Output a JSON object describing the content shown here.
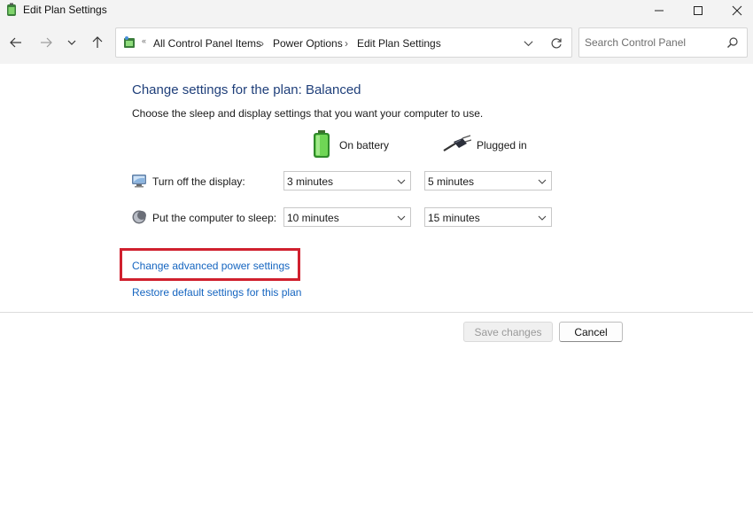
{
  "window": {
    "title": "Edit Plan Settings",
    "app_icon": "power-plan-icon",
    "controls": {
      "minimize_icon": "minimize-icon",
      "maximize_icon": "maximize-icon",
      "close_icon": "close-icon"
    }
  },
  "navigation": {
    "back_icon": "arrow-left-icon",
    "forward_icon": "arrow-right-icon",
    "recent_icon": "chevron-down-icon",
    "up_icon": "arrow-up-icon"
  },
  "address_bar": {
    "icon": "control-panel-icon",
    "overflow": "«",
    "breadcrumbs": [
      "All Control Panel Items",
      "Power Options",
      "Edit Plan Settings"
    ],
    "separator": "›",
    "dropdown_icon": "chevron-down-icon",
    "refresh_icon": "refresh-icon"
  },
  "search": {
    "placeholder": "Search Control Panel",
    "icon": "search-icon"
  },
  "content": {
    "heading": "Change settings for the plan: Balanced",
    "description": "Choose the sleep and display settings that you want your computer to use.",
    "columns": {
      "battery": {
        "label": "On battery",
        "icon": "battery-icon"
      },
      "plugged": {
        "label": "Plugged in",
        "icon": "power-plug-icon"
      }
    },
    "rows": [
      {
        "label": "Turn off the display:",
        "icon": "display-icon",
        "on_battery": "3 minutes",
        "plugged_in": "5 minutes"
      },
      {
        "label": "Put the computer to sleep:",
        "icon": "sleep-moon-icon",
        "on_battery": "10 minutes",
        "plugged_in": "15 minutes"
      }
    ],
    "links": {
      "advanced": "Change advanced power settings",
      "restore": "Restore default settings for this plan"
    },
    "highlight_color": "#d0202e"
  },
  "actions": {
    "save": {
      "label": "Save changes",
      "enabled": false
    },
    "cancel": {
      "label": "Cancel",
      "enabled": true
    }
  },
  "colors": {
    "link": "#1565c0",
    "heading": "#1f3f7a",
    "chrome_background": "#f3f3f3"
  }
}
